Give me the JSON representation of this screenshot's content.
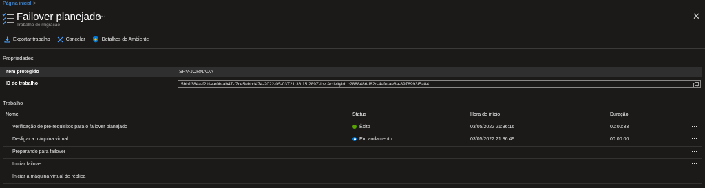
{
  "breadcrumb": {
    "home": "Página inicial",
    "sep": ">"
  },
  "header": {
    "title": "Failover planejado",
    "subtitle": "Trabalho de migração",
    "more": "···",
    "close": "✕"
  },
  "toolbar": {
    "export_label": "Exportar trabalho",
    "cancel_label": "Cancelar",
    "details_label": "Detalhes do Ambiente"
  },
  "properties": {
    "section_label": "Propriedades",
    "item_key": "Item protegido",
    "item_value": "SRV-JORNADA",
    "id_key": "ID do trabalho",
    "id_value": "5bb1384a-f2fd-4e0b-ab47-f7ce5ebbd474-2022-05-03T21:36:15.289Z-Ibz ActivityId: c2888486-f82c-4afe-ae8a-8978993f5a84"
  },
  "job": {
    "section_label": "Trabalho",
    "columns": {
      "name": "Nome",
      "status": "Status",
      "start": "Hora de início",
      "duration": "Duração"
    },
    "rows": [
      {
        "name": "Verificação de pré-requisitos para o failover planejado",
        "status": "Êxito",
        "start": "03/05/2022 21:36:16",
        "duration": "00:00:33",
        "more": "···"
      },
      {
        "name": "Desligar a máquina virtual",
        "status": "Em andamento",
        "start": "03/05/2022 21:36:49",
        "duration": "00:00:00",
        "more": "···"
      },
      {
        "name": "Preparando para failover",
        "status": "",
        "start": "",
        "duration": "",
        "more": "···"
      },
      {
        "name": "Iniciar failover",
        "status": "",
        "start": "",
        "duration": "",
        "more": "···"
      },
      {
        "name": "Iniciar a máquina virtual de réplica",
        "status": "",
        "start": "",
        "duration": "",
        "more": "···"
      }
    ]
  },
  "colors": {
    "link": "#4aa3ff",
    "success": "#57a300",
    "progress": "#0078d4",
    "background": "#1b1a19"
  }
}
